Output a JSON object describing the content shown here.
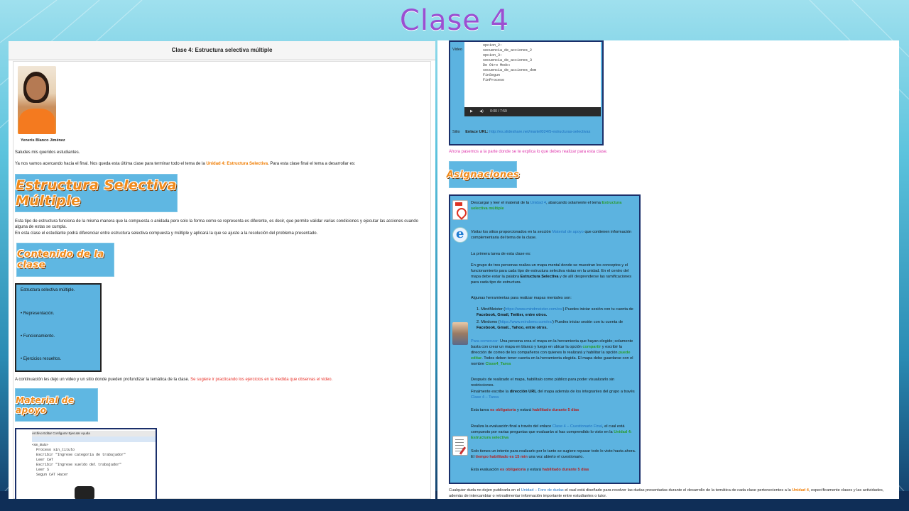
{
  "slide_title": "Clase 4",
  "left": {
    "header_title": "Clase 4: Estructura selectiva múltiple",
    "author": "Yeneris Blanco Jiménez",
    "greeting": "Saludes mis queridos estudiantes.",
    "intro_before": "Ya nos vamos acercando hacia el final. Nos queda esta última clase para terminar todo el tema de la ",
    "intro_link": "Unidad 4: Estructura Selectiva",
    "intro_after": ". Para esta clase final el tema a desarrollar es:",
    "banner_main": "Estructura Selectiva Múltiple",
    "desc1": "Esta tipo de estructura funciona de la misma manera que la compuesta o anidada pero solo la forma como se representa es diferente, es decir, que permite validar varias condiciones y ejecutar las acciones cuando alguna de estas se cumpla.",
    "desc2": "En esta clase el estudiante podrá diferenciar entre estructura selectiva compuesta y múltiple y aplicará la que se ajuste a la resolución del problema presentado.",
    "banner_content": "Contenido de la clase",
    "content_items": [
      "Estructura selectiva múltiple.",
      "• Representación.",
      "• Funcionamiento.",
      "• Ejercicios resueltos."
    ],
    "followup_before": "A continuación les dejo un video y un sitio donde pueden profundizar la temática de la clase. ",
    "followup_red": "Se sugiere ir practicando los ejercicios en la medida que observas el video.",
    "banner_support": "Material de apoyo",
    "editor_menu": "Archivo  Editar  Configurar  Ejecutar  Ayuda",
    "editor_tab": "<sin_titulo>",
    "editor_lines": [
      "Proceso sin_titulo",
      "  Escribir \"Ingrese categoría de trabajador\"",
      "  Leer CAT",
      "  Escribir \"Ingrese sueldo del trabajador\"",
      "  Leer S",
      "  Segun CAT Hacer"
    ]
  },
  "right": {
    "video_label": "Video",
    "video_lines": [
      "opcion_2:",
      "  secuencia_de_acciones_2",
      "opcion_3:",
      "  secuencia_de_acciones_3",
      "De Otro Modo:",
      "  secuencia_de_acciones_dom",
      "FinSegun",
      "FinProceso"
    ],
    "video_time": "0:00 / 7:59",
    "site_label": "Sitio",
    "site_link_label": "Enlace URL:",
    "site_url": "http://es.slideshare.net/martell024/5-estructuras-selectivas",
    "now_text": "Ahora pasemos a la parte donde se te explica lo que debes realizar para esta clase.",
    "banner_assign": "Asignaciones",
    "a1_before": "Descargar y leer el material de la ",
    "a1_link": "Unidad 4",
    "a1_mid": ", abarcando solamente el tema ",
    "a1_green": "Estructura selectiva múltiple",
    "a2_before": "Visitar los sitios proporcionados en la sección ",
    "a2_link": "Material de apoyo",
    "a2_after": " que contienen información complementaria del tema de la clase.",
    "a3_title": "La primera tarea de esta clase es:",
    "a3_body_before": "En grupo de tres personas realiza un mapa mental donde se muestran los conceptos y el funcionamiento para cada tipo de estructura selectiva vistas en la unidad. En el centro del mapa debe estar la palabra ",
    "a3_body_bold": "Estructura Selectiva",
    "a3_body_after": " y de allí desprenderse las ramificaciones para cada tipo de estructura.",
    "tools_title": "Algunas herramientas para realizar mapas mentales son:",
    "tool1_before": "1. MindMeister (",
    "tool1_url": "https://www.mindmeister.com/es/",
    "tool1_after": ") Puedes iniciar sesión con tu cuenta de ",
    "tool1_bold": "Facebook, Gmail, Twitter, entre otros.",
    "tool2_before": "2. Mindomo (",
    "tool2_url": "https://www.mindomo.com/es/",
    "tool2_after": ") Puedes iniciar sesión con tu cuenta de ",
    "tool2_bold": "Facebook, Gmail., Yahoo, entre otros.",
    "start_label": "Para comenzar:",
    "start_body": " Una persona crea el mapa en la herramienta que hayan elegido; solamente basta con crear un mapa en blanco y luego en ubicar la opción ",
    "start_green1": "compartir",
    "start_mid": " y escribir la dirección de correo de los compañeros con quienes lo realizará y habilitar la opción ",
    "start_green2": "puede editar",
    "start_end": ". Todos deben tener cuenta en la herramienta elegida. El mapa debe guardarse con el nombre ",
    "start_green3": "Clase4_Tarea",
    "after_text": "Después de realizado el mapa, habilítalo como público para poder visualizarlo sin restricciones.",
    "final_before": "Finalmente escribe la ",
    "final_bold": "dirección URL",
    "final_after": " del mapa además de los integrantes del grupo a través ",
    "final_link": "Clase 4 – Tarea",
    "task_before": "Esta tarea ",
    "task_red1": "es obligatoria",
    "task_mid": " y estará ",
    "task_red2": "habilitado durante 5 días",
    "eval_before": "Realiza la evaluación final a través del enlace ",
    "eval_link": "Clase 4 – Cuestionario Final",
    "eval_mid": ", el cual está compuesto por varias preguntas que evaluarán si has comprendido lo visto en la ",
    "eval_green": "Unidad 4: Estructura selectiva",
    "attempt_before": "Solo tienes un intento para realizarlo por lo tanto se sugiere repasar todo lo visto hasta ahora. El ",
    "attempt_red": "tiempo habilitado es 15 min",
    "attempt_after": " una vez abierto el cuestionario.",
    "eval2_before": "Esta evaluación ",
    "eval2_red1": "es obligatoria",
    "eval2_mid": " y estará ",
    "eval2_red2": "habilitado durante 5 días",
    "footer_before": "Cualquier duda no dejen publicarla en el ",
    "footer_link": "Unidad – Foro de dudas",
    "footer_mid": " el cual está diseñado para resolver las dudas presentadas durante el desarrollo de la temática de cada clase pertenecientes a la ",
    "footer_link2": "Unidad 4",
    "footer_end": ", específicamente clases y las actividades, además de intercambiar o retroalimentar información importante entre estudiantes o tutor."
  }
}
